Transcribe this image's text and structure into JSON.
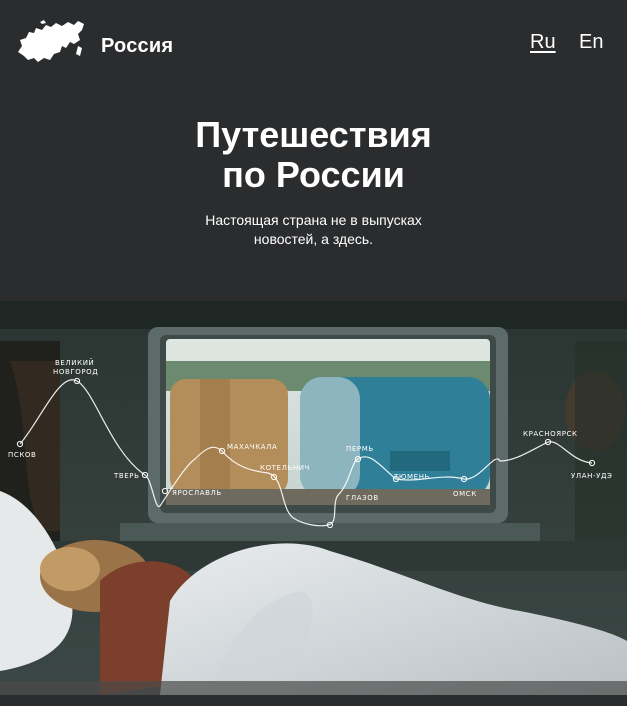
{
  "header": {
    "brand": "Россия",
    "languages": [
      {
        "label": "Ru",
        "active": true
      },
      {
        "label": "En",
        "active": false
      }
    ]
  },
  "hero": {
    "title_lines": [
      "Путешествия",
      "по России"
    ],
    "subtitle_lines": [
      "Настоящая страна не в выпусках",
      "новостей, а здесь."
    ]
  },
  "route": {
    "cities": [
      {
        "name": "ПСКОВ"
      },
      {
        "name": "ВЕЛИКИЙ НОВГОРОД"
      },
      {
        "name": "ТВЕРЬ"
      },
      {
        "name": "ЯРОСЛАВЛЬ"
      },
      {
        "name": "МАХАЧКАЛА"
      },
      {
        "name": "КОТЕЛЬНИЧ"
      },
      {
        "name": "ГЛАЗОВ"
      },
      {
        "name": "ПЕРМЬ"
      },
      {
        "name": "ТЮМЕНЬ"
      },
      {
        "name": "ОМСК"
      },
      {
        "name": "КРАСНОЯРСК"
      },
      {
        "name": "УЛАН-УДЭ"
      }
    ],
    "velikiy_line1": "ВЕЛИКИЙ",
    "velikiy_line2": "НОВГОРОД"
  },
  "colors": {
    "background": "#2b2c2e",
    "text": "#ffffff",
    "sheet": "#dfe3e6",
    "window_frame": "#6a7877"
  },
  "icons": {
    "logo": "russia-map-icon"
  }
}
